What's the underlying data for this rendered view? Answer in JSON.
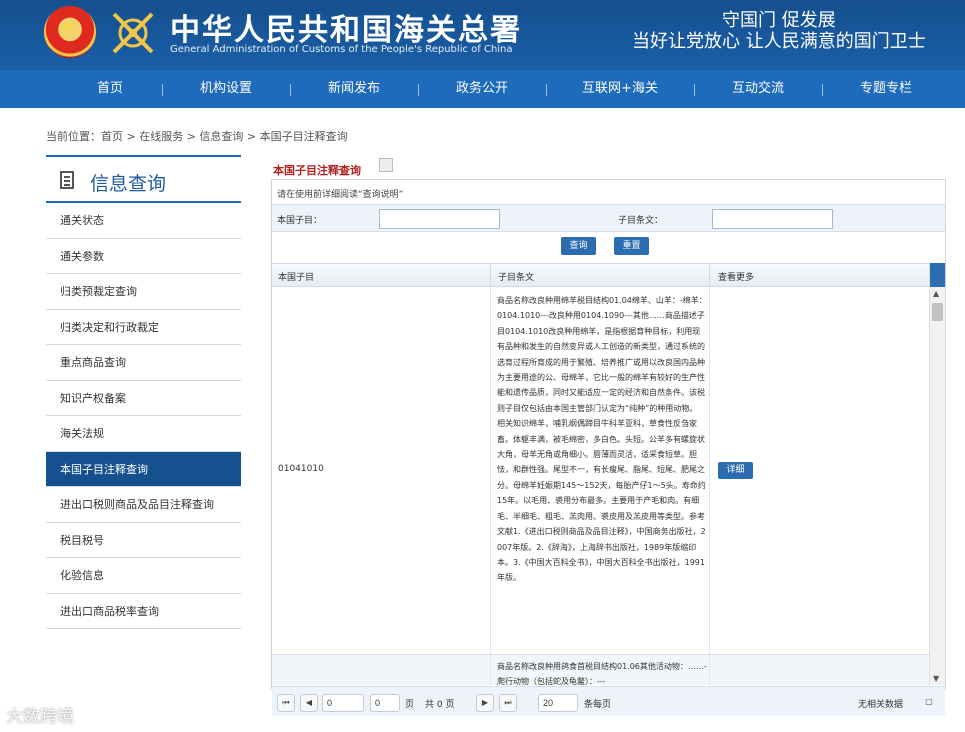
{
  "header": {
    "title": "中华人民共和国海关总署",
    "subtitle": "General Administration of Customs of the People's Republic of China",
    "slogan_line1": "守国门    促发展",
    "slogan_line2": "当好让党放心    让人民满意的国门卫士"
  },
  "nav": {
    "items": [
      "首页",
      "机构设置",
      "新闻发布",
      "政务公开",
      "互联网+海关",
      "互动交流",
      "专题专栏"
    ]
  },
  "breadcrumb": {
    "prefix": "当前位置：",
    "items": [
      "首页",
      "在线服务",
      "信息查询",
      "本国子目注释查询"
    ],
    "separator": " > "
  },
  "sidebar": {
    "title": "信息查询",
    "items": [
      "通关状态",
      "通关参数",
      "归类预裁定查询",
      "归类决定和行政裁定",
      "重点商品查询",
      "知识产权备案",
      "海关法规",
      "本国子目注释查询",
      "进出口税则商品及品目注释查询",
      "税目税号",
      "化验信息",
      "进出口商品税率查询"
    ],
    "active_index": 7
  },
  "panel": {
    "title": "本国子目注释查询",
    "tip": "请在使用前详细阅读“查询说明”",
    "label_subheading": "本国子目：",
    "label_text": "子目条文：",
    "subheading_value": "",
    "text_value": "",
    "query_button": "查询",
    "reset_button": "重置"
  },
  "grid": {
    "columns": [
      "本国子目",
      "子目条文",
      "查看更多"
    ],
    "rows": [
      {
        "code": "01041010",
        "text": "商品名称改良种用绵羊税目结构01.04绵羊、山羊：-绵羊：0104.1010---改良种用0104.1090---其他……商品描述子目0104.1010改良种用绵羊，是指根据育种目标，利用现有品种和发生的自然变异或人工创造的新类型，通过系统的选育过程所育成的用于繁殖、培养推广或用以改良国内品种为主要用途的公、母绵羊，它比一般的绵羊有较好的生产性能和遗传品质，同时又能适应一定的经济和自然条件。该税则子目仅包括由本国主管部门认定为“纯种”的种用动物。 相关知识绵羊，哺乳纲偶蹄目牛科羊亚科，草食性反刍家畜。体躯丰满，被毛绵密，多白色。头短。公羊多有螺旋状大角，母羊无角或角细小。唇薄而灵活，适采食短草。胆怯，和群性强。尾型不一，有长瘦尾、脂尾、短尾、肥尾之分。母绵羊妊娠期145～152天，每胎产仔1～5头。寿命约15年。以毛用、裘用分布最多。主要用于产毛和肉。有细毛、半细毛、粗毛、羔肉用、裘皮用及羔皮用等类型。参考文献1.《进出口税则商品及品目注释》，中国商务出版社，2007年版。2.《辞海》，上海辞书出版社，1989年版缩印本。3.《中国大百科全书》，中国大百科全书出版社，1991年版。",
        "more": "详细"
      },
      {
        "code": "",
        "text": "商品名称改良种用鸽食首税目结构01.06其他活动物：……-爬行动物（包括蛇及龟鳖）：---",
        "more": ""
      }
    ]
  },
  "pager": {
    "current_page": "0",
    "page_label": "页",
    "total_label": "共 0 页",
    "page_size": "20",
    "page_size_label": "条每页",
    "status": "无相关数据"
  },
  "watermark": "大数跨境"
}
